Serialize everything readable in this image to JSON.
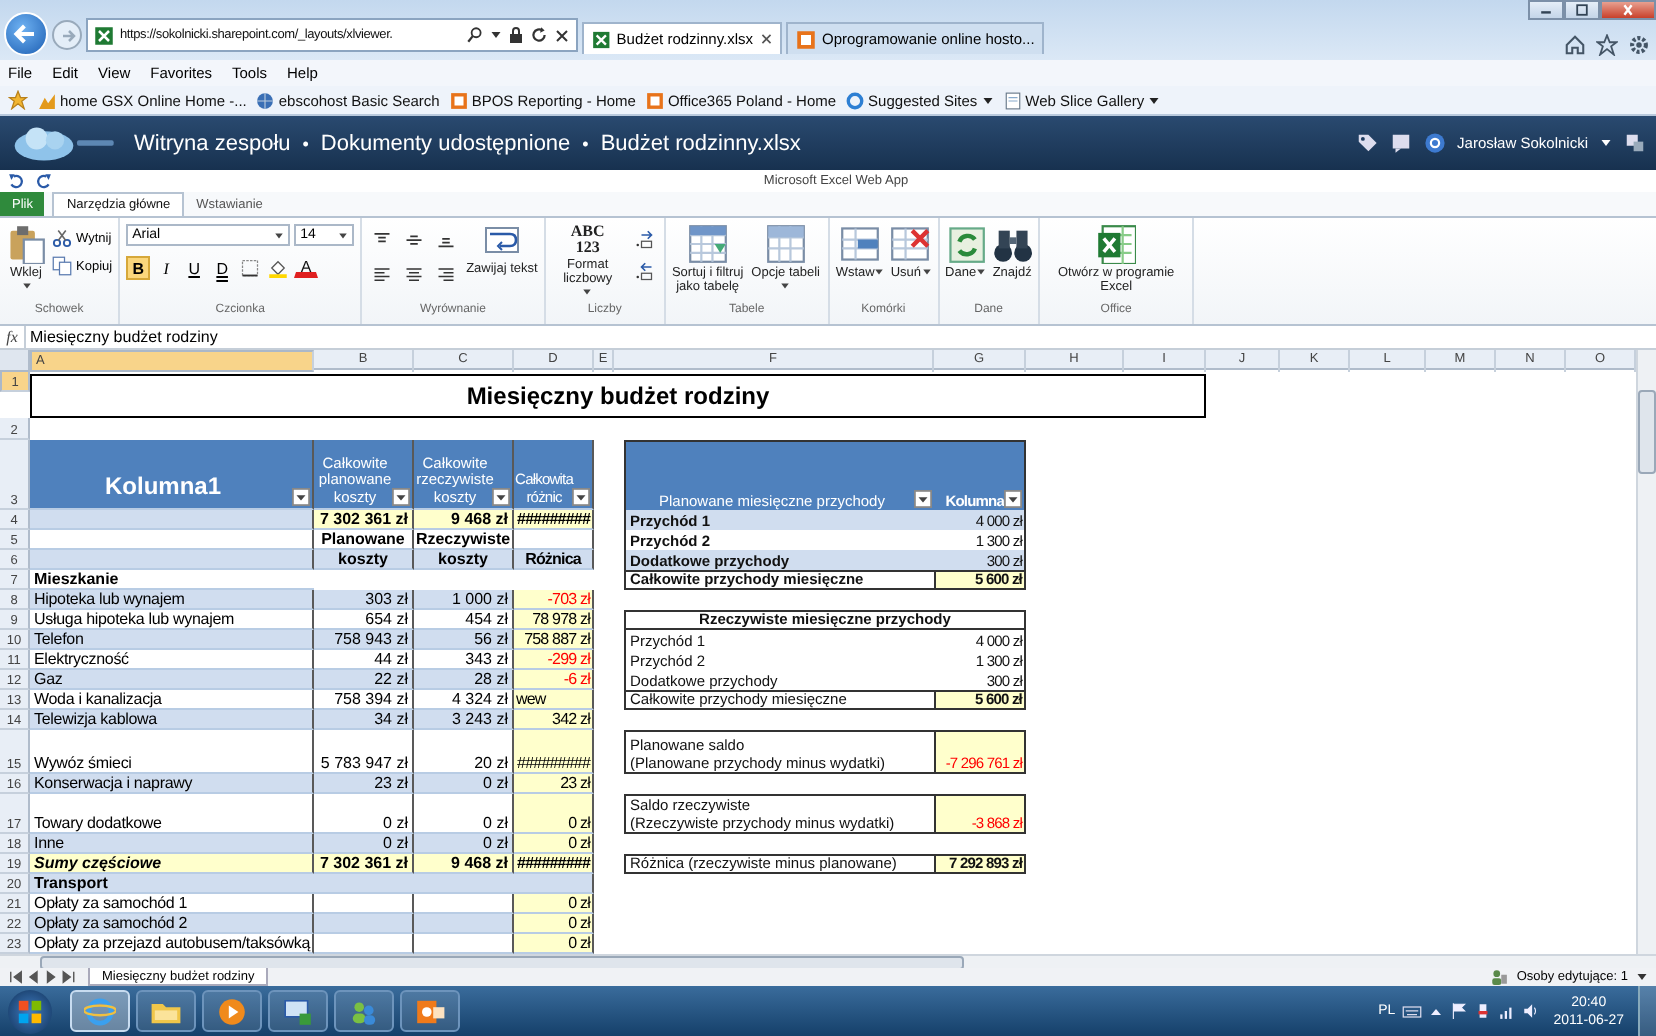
{
  "browser": {
    "address": "https://sokolnicki.sharepoint.com/_layouts/xlviewer.",
    "tabs": [
      {
        "label": "Budżet rodzinny.xlsx",
        "kind": "excel",
        "selected": true
      },
      {
        "label": "Oprogramowanie online hosto...",
        "kind": "office",
        "selected": false
      }
    ],
    "menu": [
      "File",
      "Edit",
      "View",
      "Favorites",
      "Tools",
      "Help"
    ],
    "favorites": [
      {
        "label": "home GSX Online Home -...",
        "kind": "chart",
        "dropdown": false
      },
      {
        "label": "ebscohost Basic Search",
        "kind": "globe",
        "dropdown": false
      },
      {
        "label": "BPOS Reporting - Home",
        "kind": "office",
        "dropdown": false
      },
      {
        "label": "Office365 Poland - Home",
        "kind": "office",
        "dropdown": false
      },
      {
        "label": "Suggested Sites",
        "kind": "ie",
        "dropdown": true
      },
      {
        "label": "Web Slice Gallery",
        "kind": "page",
        "dropdown": true
      }
    ]
  },
  "site": {
    "breadcrumb": [
      {
        "label": "Witryna zespołu",
        "separator": "•"
      },
      {
        "label": "Dokumenty udostępnione",
        "separator": "•"
      },
      {
        "label": "Budżet rodzinny.xlsx"
      }
    ],
    "user": "Jarosław Sokolnicki"
  },
  "app_title": "Microsoft Excel Web App",
  "ribbon": {
    "tabs": [
      {
        "label": "Plik",
        "kind": "file",
        "selected": false
      },
      {
        "label": "Narzędzia główne",
        "kind": "tab",
        "selected": true
      },
      {
        "label": "Wstawianie",
        "kind": "tab",
        "selected": false
      }
    ],
    "groups": [
      {
        "label": "Schowek",
        "kind": "clipboard",
        "items": [
          {
            "kind": "paste",
            "label": "Wklej",
            "dropdown": true
          },
          {
            "kind": "cut",
            "label": "Wytnij"
          },
          {
            "kind": "copy",
            "label": "Kopiuj"
          }
        ]
      },
      {
        "label": "Czcionka",
        "kind": "font",
        "font": "Arial",
        "size": "14",
        "items": [
          {
            "kind": "bold",
            "label": "B",
            "on": true
          },
          {
            "kind": "italic",
            "label": "I",
            "on": false
          },
          {
            "kind": "underline",
            "label": "U",
            "on": false
          },
          {
            "kind": "dunderline",
            "label": "D",
            "on": false
          },
          {
            "kind": "borders",
            "on": false
          },
          {
            "kind": "fill",
            "on": false
          },
          {
            "kind": "fontcolor",
            "label": "A",
            "on": false
          }
        ]
      },
      {
        "label": "Wyrównanie",
        "kind": "align",
        "items": [
          {
            "kind": "top"
          },
          {
            "kind": "middle"
          },
          {
            "kind": "bottom"
          },
          {
            "kind": "left"
          },
          {
            "kind": "center"
          },
          {
            "kind": "right"
          },
          {
            "kind": "wrap",
            "label": "Zawijaj tekst"
          }
        ]
      },
      {
        "label": "Liczby",
        "kind": "number",
        "items": [
          {
            "kind": "format",
            "label": "Format liczbowy",
            "glyph": [
              "ABC",
              "123"
            ],
            "dropdown": true
          },
          {
            "kind": "incdec"
          },
          {
            "kind": "decdec"
          }
        ]
      },
      {
        "label": "Tabele",
        "kind": "big",
        "items": [
          {
            "kind": "sort",
            "label": "Sortuj i filtruj jako tabelę",
            "dropdown": false
          },
          {
            "kind": "tableopts",
            "label": "Opcje tabeli",
            "dropdown": true
          }
        ]
      },
      {
        "label": "Komórki",
        "kind": "big",
        "items": [
          {
            "kind": "insert",
            "label": "Wstaw",
            "dropdown": true
          },
          {
            "kind": "delete",
            "label": "Usuń",
            "dropdown": true
          }
        ]
      },
      {
        "label": "Dane",
        "kind": "big",
        "items": [
          {
            "kind": "data",
            "label": "Dane",
            "dropdown": true
          },
          {
            "kind": "find",
            "label": "Znajdź",
            "dropdown": false
          }
        ]
      },
      {
        "label": "Office",
        "kind": "big",
        "items": [
          {
            "kind": "excel",
            "label": "Otwórz w programie Excel",
            "dropdown": false
          }
        ]
      }
    ]
  },
  "formula_bar": {
    "label": "fx",
    "value": "Miesięczny budżet rodziny"
  },
  "sheet": {
    "columns": [
      {
        "label": "A",
        "selected": true
      },
      {
        "label": "B",
        "selected": false
      },
      {
        "label": "C",
        "selected": false
      },
      {
        "label": "D",
        "selected": false
      },
      {
        "label": "E",
        "selected": false
      },
      {
        "label": "F",
        "selected": false
      },
      {
        "label": "G",
        "selected": false
      },
      {
        "label": "H",
        "selected": false
      },
      {
        "label": "I",
        "selected": false
      },
      {
        "label": "J",
        "selected": false
      },
      {
        "label": "K",
        "selected": false
      },
      {
        "label": "L",
        "selected": false
      },
      {
        "label": "M",
        "selected": false
      },
      {
        "label": "N",
        "selected": false
      },
      {
        "label": "O",
        "selected": false
      }
    ],
    "rows": [
      {
        "number": "1",
        "selected": true,
        "kind": "title",
        "text": "Miesięczny budżet rodziny"
      },
      {
        "number": "2",
        "selected": false,
        "kind": "data"
      },
      {
        "number": "3",
        "selected": false,
        "kind": "data",
        "left": [
          {
            "text": "Kolumna1",
            "kind": "head"
          },
          {
            "text": "Całkowite planowane koszty",
            "kind": "head"
          },
          {
            "text": "Całkowite rzeczywiste koszty",
            "kind": "head"
          },
          {
            "text": "Całkowita różnic",
            "kind": "head"
          }
        ],
        "right": [
          {
            "text": "Planowane miesięczne przychody",
            "kind": "head"
          },
          {
            "text": "Kolumna",
            "kind": "head"
          }
        ]
      },
      {
        "number": "4",
        "selected": false,
        "kind": "data",
        "band": true,
        "left": [
          {
            "kind": "blank"
          },
          {
            "text": "7 302 361 zł",
            "kind": "total"
          },
          {
            "text": "9 468 zł",
            "kind": "total"
          },
          {
            "text": "#########",
            "kind": "total"
          }
        ],
        "right": [
          {
            "text": "Przychód 1",
            "kind": "tlabel"
          },
          {
            "text": "4 000 zł",
            "kind": "tamount"
          }
        ]
      },
      {
        "number": "5",
        "selected": false,
        "kind": "data",
        "band": false,
        "left": [
          {
            "kind": "blank"
          },
          {
            "text": "Planowane",
            "kind": "sub"
          },
          {
            "text": "Rzeczywiste",
            "kind": "sub"
          },
          {
            "kind": "blank"
          }
        ],
        "right": [
          {
            "text": "Przychód 2",
            "kind": "tlabel"
          },
          {
            "text": "1 300 zł",
            "kind": "tamount"
          }
        ]
      },
      {
        "number": "6",
        "selected": false,
        "kind": "data",
        "band": true,
        "left": [
          {
            "kind": "blank"
          },
          {
            "text": "koszty",
            "kind": "sub"
          },
          {
            "text": "koszty",
            "kind": "sub"
          },
          {
            "text": "Różnica",
            "kind": "sub"
          }
        ],
        "right": [
          {
            "text": "Dodatkowe przychody",
            "kind": "tlabel"
          },
          {
            "text": "300 zł",
            "kind": "tamount"
          }
        ]
      },
      {
        "number": "7",
        "selected": false,
        "kind": "data",
        "band": false,
        "left": [
          {
            "text": "Mieszkanie",
            "kind": "section"
          }
        ],
        "right": [
          {
            "text": "Całkowite przychody miesięczne",
            "kind": "tlabel"
          },
          {
            "text": "5 600 zł",
            "kind": "total"
          }
        ]
      },
      {
        "number": "8",
        "selected": false,
        "kind": "data",
        "band": true,
        "left": [
          {
            "text": "Hipoteka lub wynajem",
            "kind": "label"
          },
          {
            "text": "303 zł",
            "kind": "num"
          },
          {
            "text": "1 000 zł",
            "kind": "num"
          },
          {
            "text": "-703 zł",
            "kind": "neg"
          }
        ]
      },
      {
        "number": "9",
        "selected": false,
        "kind": "data",
        "band": false,
        "left": [
          {
            "text": "Usługa hipoteka lub wynajem",
            "kind": "label"
          },
          {
            "text": "654 zł",
            "kind": "num"
          },
          {
            "text": "454 zł",
            "kind": "num"
          },
          {
            "text": "78 978 zł",
            "kind": "diff"
          }
        ],
        "right": [
          {
            "text": "Rzeczywiste miesięczne przychody",
            "kind": "caption"
          }
        ]
      },
      {
        "number": "10",
        "selected": false,
        "kind": "data",
        "band": true,
        "left": [
          {
            "text": "Telefon",
            "kind": "label"
          },
          {
            "text": "758 943 zł",
            "kind": "num"
          },
          {
            "text": "56 zł",
            "kind": "num"
          },
          {
            "text": "758 887 zł",
            "kind": "diff"
          }
        ],
        "right": [
          {
            "text": "Przychód 1",
            "kind": "label"
          },
          {
            "text": "4 000 zł",
            "kind": "amount"
          }
        ]
      },
      {
        "number": "11",
        "selected": false,
        "kind": "data",
        "band": false,
        "left": [
          {
            "text": "Elektryczność",
            "kind": "label"
          },
          {
            "text": "44 zł",
            "kind": "num"
          },
          {
            "text": "343 zł",
            "kind": "num"
          },
          {
            "text": "-299 zł",
            "kind": "neg"
          }
        ],
        "right": [
          {
            "text": "Przychód 2",
            "kind": "label"
          },
          {
            "text": "1 300 zł",
            "kind": "amount"
          }
        ]
      },
      {
        "number": "12",
        "selected": false,
        "kind": "data",
        "band": true,
        "left": [
          {
            "text": "Gaz",
            "kind": "label"
          },
          {
            "text": "22 zł",
            "kind": "num"
          },
          {
            "text": "28 zł",
            "kind": "num"
          },
          {
            "text": "-6 zł",
            "kind": "neg"
          }
        ],
        "right": [
          {
            "text": "Dodatkowe przychody",
            "kind": "label"
          },
          {
            "text": "300 zł",
            "kind": "amount"
          }
        ]
      },
      {
        "number": "13",
        "selected": false,
        "kind": "data",
        "band": false,
        "left": [
          {
            "text": "Woda i kanalizacja",
            "kind": "label"
          },
          {
            "text": "758 394 zł",
            "kind": "num"
          },
          {
            "text": "4 324 zł",
            "kind": "num"
          },
          {
            "text": "wew",
            "kind": "note"
          }
        ],
        "right": [
          {
            "text": "Całkowite przychody miesięczne",
            "kind": "label"
          },
          {
            "text": "5 600 zł",
            "kind": "total"
          }
        ]
      },
      {
        "number": "14",
        "selected": false,
        "kind": "data",
        "band": true,
        "left": [
          {
            "text": "Telewizja kablowa",
            "kind": "label"
          },
          {
            "text": "34 zł",
            "kind": "num"
          },
          {
            "text": "3 243 zł",
            "kind": "num"
          },
          {
            "text": "342 zł",
            "kind": "diff"
          }
        ]
      },
      {
        "number": "15",
        "selected": false,
        "kind": "data",
        "band": false,
        "left": [
          {
            "text": "Wywóz śmieci",
            "kind": "label"
          },
          {
            "text": "5 783 947 zł",
            "kind": "num"
          },
          {
            "text": "20 zł",
            "kind": "num"
          },
          {
            "text": "#########",
            "kind": "diff"
          }
        ],
        "right": [
          {
            "text": "Planowane saldo\n(Planowane przychody minus wydatki)",
            "kind": "label"
          },
          {
            "text": "-7 296 761 zł",
            "kind": "neg"
          }
        ]
      },
      {
        "number": "16",
        "selected": false,
        "kind": "data",
        "band": true,
        "left": [
          {
            "text": "Konserwacja i naprawy",
            "kind": "label"
          },
          {
            "text": "23 zł",
            "kind": "num"
          },
          {
            "text": "0 zł",
            "kind": "num"
          },
          {
            "text": "23 zł",
            "kind": "diff"
          }
        ]
      },
      {
        "number": "17",
        "selected": false,
        "kind": "data",
        "band": false,
        "left": [
          {
            "text": "Towary dodatkowe",
            "kind": "label"
          },
          {
            "text": "0 zł",
            "kind": "num"
          },
          {
            "text": "0 zł",
            "kind": "num"
          },
          {
            "text": "0 zł",
            "kind": "diff"
          }
        ],
        "right": [
          {
            "text": "Saldo rzeczywiste\n(Rzeczywiste przychody minus wydatki)",
            "kind": "label"
          },
          {
            "text": "-3 868 zł",
            "kind": "neg"
          }
        ]
      },
      {
        "number": "18",
        "selected": false,
        "kind": "data",
        "band": true,
        "left": [
          {
            "text": "Inne",
            "kind": "label"
          },
          {
            "text": "0 zł",
            "kind": "num"
          },
          {
            "text": "0 zł",
            "kind": "num"
          },
          {
            "text": "0 zł",
            "kind": "diff"
          }
        ]
      },
      {
        "number": "19",
        "selected": false,
        "kind": "data",
        "band": false,
        "left": [
          {
            "text": "Sumy częściowe",
            "kind": "subtotal"
          },
          {
            "text": "7 302 361 zł",
            "kind": "total"
          },
          {
            "text": "9 468 zł",
            "kind": "total"
          },
          {
            "text": "#########",
            "kind": "total"
          }
        ],
        "right": [
          {
            "text": "Różnica (rzeczywiste minus planowane)",
            "kind": "label"
          },
          {
            "text": "7 292 893 zł",
            "kind": "total"
          }
        ]
      },
      {
        "number": "20",
        "selected": false,
        "kind": "data",
        "band": true,
        "left": [
          {
            "text": "Transport",
            "kind": "group"
          }
        ]
      },
      {
        "number": "21",
        "selected": false,
        "kind": "data",
        "band": false,
        "left": [
          {
            "text": "Opłaty za samochód 1",
            "kind": "label"
          },
          {
            "kind": "blank"
          },
          {
            "kind": "blank"
          },
          {
            "text": "0 zł",
            "kind": "diff"
          }
        ]
      },
      {
        "number": "22",
        "selected": false,
        "kind": "data",
        "band": true,
        "left": [
          {
            "text": "Opłaty za samochód 2",
            "kind": "label"
          },
          {
            "kind": "blank"
          },
          {
            "kind": "blank"
          },
          {
            "text": "0 zł",
            "kind": "diff"
          }
        ]
      },
      {
        "number": "23",
        "selected": false,
        "kind": "data",
        "band": false,
        "left": [
          {
            "text": "Opłaty za przejazd autobusem/taksówką",
            "kind": "label"
          },
          {
            "kind": "blank"
          },
          {
            "kind": "blank"
          },
          {
            "text": "0 zł",
            "kind": "diff"
          }
        ]
      }
    ]
  },
  "sheet_tabs": {
    "tabs": [
      {
        "label": "Miesięczny budżet rodziny",
        "selected": true
      }
    ],
    "editors": "Osoby edytujące: 1"
  },
  "taskbar": {
    "apps": [
      {
        "kind": "ie",
        "selected": true
      },
      {
        "kind": "folder",
        "selected": false
      },
      {
        "kind": "media",
        "selected": false
      },
      {
        "kind": "remote",
        "selected": false
      },
      {
        "kind": "people",
        "selected": false
      },
      {
        "kind": "outlook",
        "selected": false
      }
    ],
    "language": "PL",
    "time": "20:40",
    "date": "2011-06-27"
  }
}
